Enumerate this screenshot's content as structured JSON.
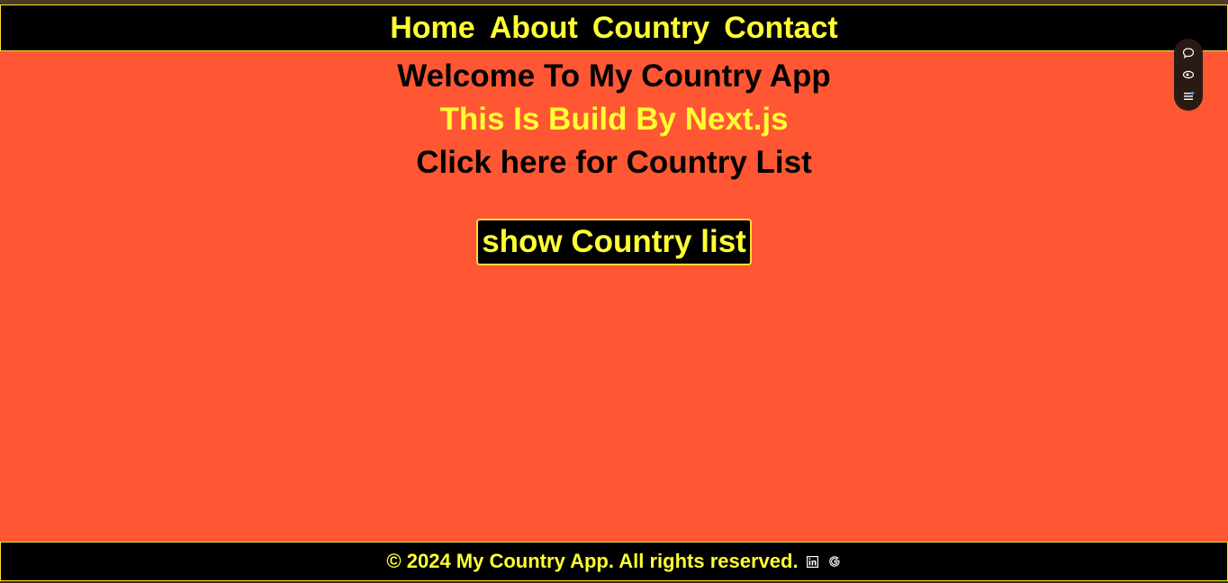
{
  "nav": {
    "items": [
      {
        "label": "Home"
      },
      {
        "label": "About"
      },
      {
        "label": "Country"
      },
      {
        "label": "Contact"
      }
    ]
  },
  "main": {
    "welcome": "Welcome To My Country App",
    "subtitle": "This Is Build By Next.js",
    "cta_text": "Click here for Country List",
    "button_label": "show Country list"
  },
  "footer": {
    "text": "© 2024 My Country App. All rights reserved.",
    "icons": [
      "linkedin-icon",
      "google-icon"
    ]
  },
  "widget": {
    "icons": [
      "chat-bubble-icon",
      "eye-icon",
      "list-icon"
    ]
  },
  "colors": {
    "background": "#ff5733",
    "accent": "#ffff33",
    "navbar": "#000000"
  }
}
